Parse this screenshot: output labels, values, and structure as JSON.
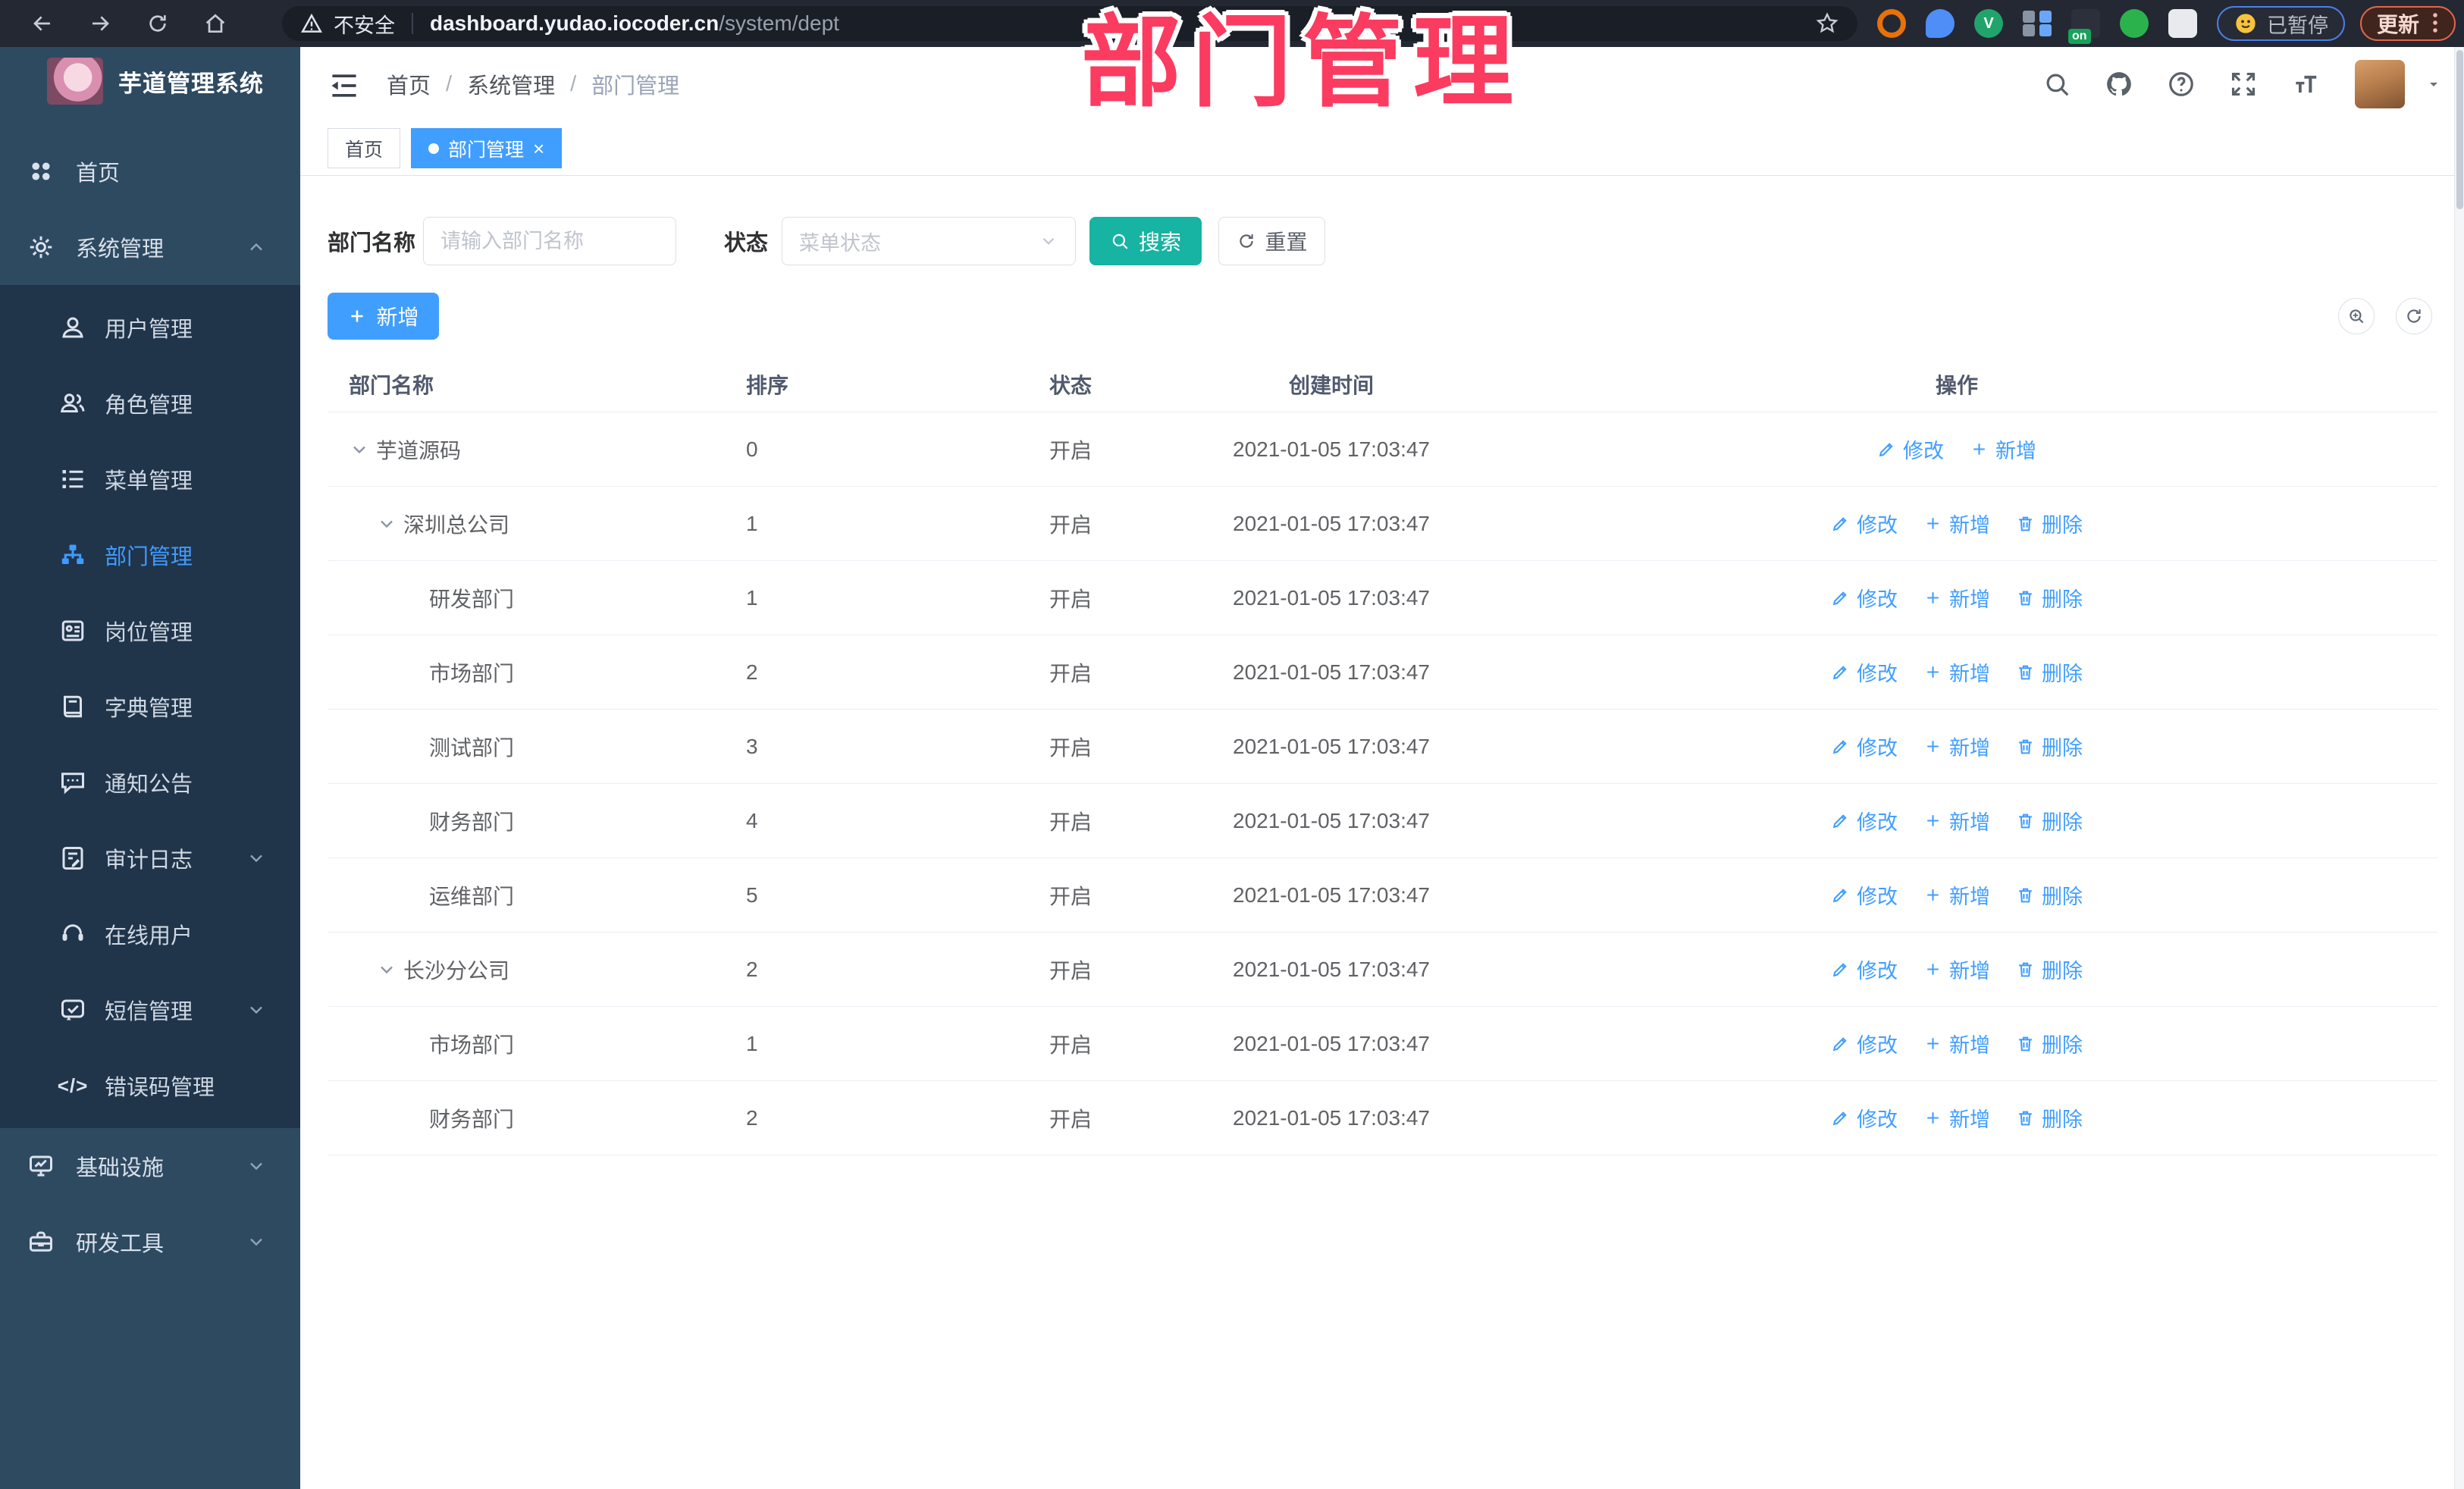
{
  "colors": {
    "accent_blue": "#409eff",
    "search_teal": "#17b3a3",
    "annotation_pink": "#fb3b5f",
    "sidebar_bg": "#2e4a61",
    "submenu_bg": "#20344a",
    "active_tab_bg": "#409eff"
  },
  "browser": {
    "nav_icons": [
      "back-icon",
      "forward-icon",
      "reload-icon",
      "home-icon"
    ],
    "security_label": "不安全",
    "url_host": "dashboard.yudao.iocoder.cn",
    "url_path": "/system/dept",
    "bookmark_icon": "star-icon",
    "extensions": [
      {
        "id": "orange-ring-extension-icon",
        "color": "#e8710a",
        "shape": "ring"
      },
      {
        "id": "location-extension-icon",
        "color": "#4f8df7",
        "shape": "drop"
      },
      {
        "id": "green-v-extension-icon",
        "color": "#21a46c",
        "shape": "circle",
        "glyph": "V"
      },
      {
        "id": "grid-extension-icon",
        "color": "#8a93a3",
        "shape": "grid"
      },
      {
        "id": "list-on-extension-icon",
        "color": "#2b303a",
        "shape": "square",
        "badge": "on"
      },
      {
        "id": "green-magnifier-extension-icon",
        "color": "#2bb24c",
        "shape": "circle",
        "glyph": ""
      },
      {
        "id": "puzzle-extension-icon",
        "color": "#e8eaed",
        "shape": "puzzle"
      }
    ],
    "paused_label": "已暂停",
    "update_label": "更新"
  },
  "annotation": {
    "text": "部门管理"
  },
  "sidebar": {
    "app_title": "芋道管理系统",
    "menu": [
      {
        "label": "首页",
        "icon": "dashboard-icon",
        "type": "root"
      },
      {
        "label": "系统管理",
        "icon": "gear-icon",
        "type": "root",
        "chevron": "up"
      },
      {
        "label": "用户管理",
        "icon": "user-icon",
        "type": "sub"
      },
      {
        "label": "角色管理",
        "icon": "users-icon",
        "type": "sub"
      },
      {
        "label": "菜单管理",
        "icon": "menu-list-icon",
        "type": "sub"
      },
      {
        "label": "部门管理",
        "icon": "org-tree-icon",
        "type": "sub",
        "active": true
      },
      {
        "label": "岗位管理",
        "icon": "badge-icon",
        "type": "sub"
      },
      {
        "label": "字典管理",
        "icon": "book-icon",
        "type": "sub"
      },
      {
        "label": "通知公告",
        "icon": "announcement-icon",
        "type": "sub"
      },
      {
        "label": "审计日志",
        "icon": "log-icon",
        "type": "sub",
        "chevron": "down"
      },
      {
        "label": "在线用户",
        "icon": "online-users-icon",
        "type": "sub"
      },
      {
        "label": "短信管理",
        "icon": "sms-icon",
        "type": "sub",
        "chevron": "down"
      },
      {
        "label": "错误码管理",
        "icon": "code-icon",
        "type": "sub"
      },
      {
        "label": "基础设施",
        "icon": "infrastructure-icon",
        "type": "root",
        "chevron": "down"
      },
      {
        "label": "研发工具",
        "icon": "dev-tools-icon",
        "type": "root",
        "chevron": "down"
      }
    ]
  },
  "header": {
    "breadcrumb": [
      "首页",
      "系统管理",
      "部门管理"
    ],
    "right_icons": [
      "search-icon",
      "github-icon",
      "help-icon",
      "fullscreen-icon",
      "font-size-icon"
    ]
  },
  "tabs": [
    {
      "label": "首页",
      "active": false
    },
    {
      "label": "部门管理",
      "active": true,
      "closable": true
    }
  ],
  "filters": {
    "dept_label": "部门名称",
    "dept_placeholder": "请输入部门名称",
    "dept_value": "",
    "status_label": "状态",
    "status_placeholder": "菜单状态",
    "search_label": "搜索",
    "reset_label": "重置"
  },
  "toolbar": {
    "add_label": "新增",
    "circle_buttons": [
      "search-toggle-icon",
      "refresh-icon"
    ]
  },
  "table": {
    "columns": [
      "部门名称",
      "排序",
      "状态",
      "创建时间",
      "操作"
    ],
    "action_defs": {
      "edit": {
        "label": "修改",
        "icon": "edit-icon"
      },
      "add": {
        "label": "新增",
        "icon": "plus-icon"
      },
      "delete": {
        "label": "删除",
        "icon": "trash-icon"
      }
    },
    "rows": [
      {
        "name": "芋道源码",
        "level": 0,
        "expandable": true,
        "sort": "0",
        "status": "开启",
        "created": "2021-01-05 17:03:47",
        "actions": [
          "edit",
          "add"
        ]
      },
      {
        "name": "深圳总公司",
        "level": 1,
        "expandable": true,
        "sort": "1",
        "status": "开启",
        "created": "2021-01-05 17:03:47",
        "actions": [
          "edit",
          "add",
          "delete"
        ]
      },
      {
        "name": "研发部门",
        "level": 2,
        "expandable": false,
        "sort": "1",
        "status": "开启",
        "created": "2021-01-05 17:03:47",
        "actions": [
          "edit",
          "add",
          "delete"
        ]
      },
      {
        "name": "市场部门",
        "level": 2,
        "expandable": false,
        "sort": "2",
        "status": "开启",
        "created": "2021-01-05 17:03:47",
        "actions": [
          "edit",
          "add",
          "delete"
        ]
      },
      {
        "name": "测试部门",
        "level": 2,
        "expandable": false,
        "sort": "3",
        "status": "开启",
        "created": "2021-01-05 17:03:47",
        "actions": [
          "edit",
          "add",
          "delete"
        ]
      },
      {
        "name": "财务部门",
        "level": 2,
        "expandable": false,
        "sort": "4",
        "status": "开启",
        "created": "2021-01-05 17:03:47",
        "actions": [
          "edit",
          "add",
          "delete"
        ]
      },
      {
        "name": "运维部门",
        "level": 2,
        "expandable": false,
        "sort": "5",
        "status": "开启",
        "created": "2021-01-05 17:03:47",
        "actions": [
          "edit",
          "add",
          "delete"
        ]
      },
      {
        "name": "长沙分公司",
        "level": 1,
        "expandable": true,
        "sort": "2",
        "status": "开启",
        "created": "2021-01-05 17:03:47",
        "actions": [
          "edit",
          "add",
          "delete"
        ]
      },
      {
        "name": "市场部门",
        "level": 2,
        "expandable": false,
        "sort": "1",
        "status": "开启",
        "created": "2021-01-05 17:03:47",
        "actions": [
          "edit",
          "add",
          "delete"
        ]
      },
      {
        "name": "财务部门",
        "level": 2,
        "expandable": false,
        "sort": "2",
        "status": "开启",
        "created": "2021-01-05 17:03:47",
        "actions": [
          "edit",
          "add",
          "delete"
        ]
      }
    ]
  }
}
